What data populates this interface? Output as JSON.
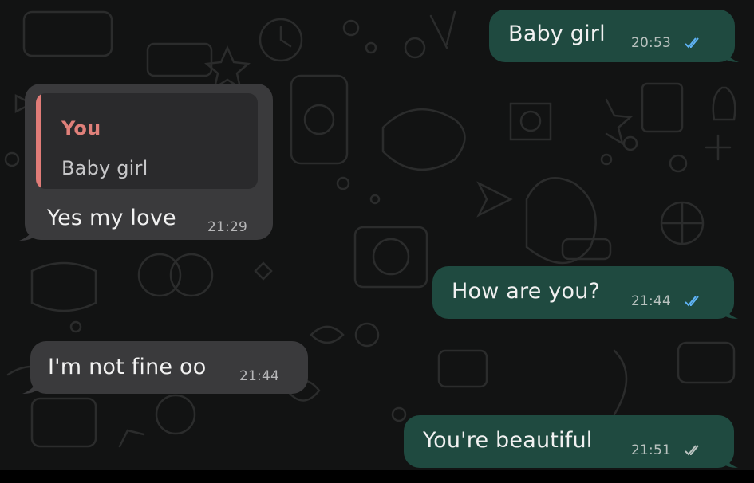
{
  "messages": [
    {
      "direction": "out",
      "text": "Baby girl",
      "time": "20:53",
      "status": "read"
    },
    {
      "direction": "in",
      "reply_to": {
        "author": "You",
        "text": "Baby girl"
      },
      "text": "Yes my love",
      "time": "21:29"
    },
    {
      "direction": "out",
      "text": "How are you?",
      "time": "21:44",
      "status": "read"
    },
    {
      "direction": "in",
      "text": "I'm not fine oo",
      "time": "21:44"
    },
    {
      "direction": "out",
      "text": "You're beautiful",
      "time": "21:51",
      "status": "delivered"
    }
  ],
  "colors": {
    "background": "#121313",
    "incoming_bubble": "#3a3a3c",
    "outgoing_bubble": "#1f4a40",
    "quote_accent": "#e07c78",
    "read_ticks": "#5fb3f5",
    "delivered_ticks": "#b9c2bf"
  }
}
